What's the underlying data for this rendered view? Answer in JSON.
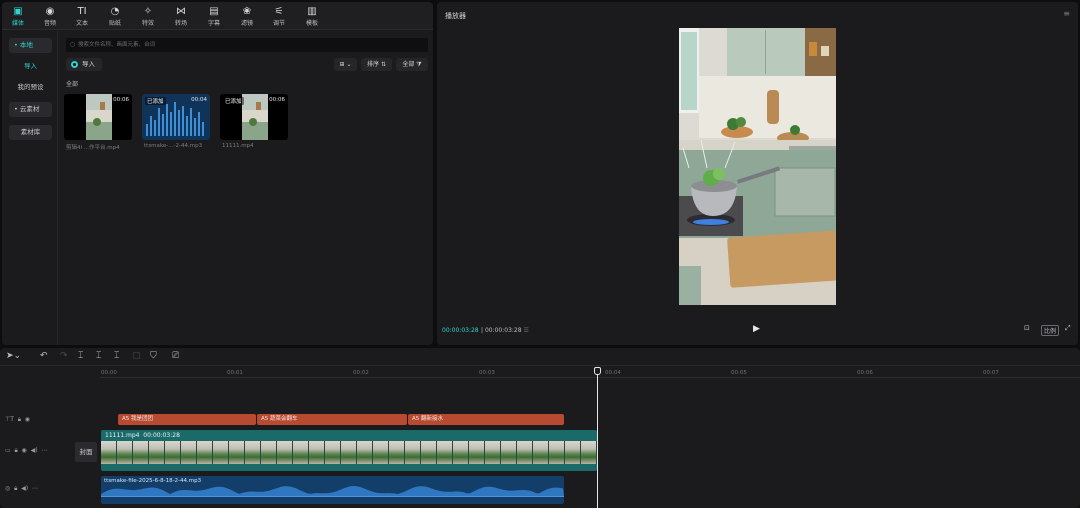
{
  "toolbar": {
    "items": [
      {
        "label": "媒体",
        "icon": "media-icon",
        "glyph": "▣"
      },
      {
        "label": "音频",
        "icon": "audio-icon",
        "glyph": "◉"
      },
      {
        "label": "文本",
        "icon": "text-icon",
        "glyph": "TI"
      },
      {
        "label": "贴纸",
        "icon": "sticker-icon",
        "glyph": "◔"
      },
      {
        "label": "特效",
        "icon": "effects-icon",
        "glyph": "✧"
      },
      {
        "label": "转场",
        "icon": "transition-icon",
        "glyph": "⋈"
      },
      {
        "label": "字幕",
        "icon": "captions-icon",
        "glyph": "▤"
      },
      {
        "label": "滤镜",
        "icon": "filter-icon",
        "glyph": "❀"
      },
      {
        "label": "调节",
        "icon": "adjust-icon",
        "glyph": "⚟"
      },
      {
        "label": "模板",
        "icon": "template-icon",
        "glyph": "▥"
      }
    ],
    "accent": "#2fd3d0"
  },
  "sidebar": {
    "items": [
      {
        "label": "• 本地"
      },
      {
        "label": "导入"
      },
      {
        "label": "我的预设"
      },
      {
        "label": "• 云素材"
      },
      {
        "label": "素材库"
      }
    ]
  },
  "search": {
    "placeholder": "搜索文件名称、画面元素、台词"
  },
  "media": {
    "import_label": "导入",
    "sort_label": "排序",
    "filter_label": "全部",
    "section_label": "全部",
    "items": [
      {
        "name": "剪辑4i ...作平台.mp4",
        "duration": "00:06",
        "badge": ""
      },
      {
        "name": "ttsmake-...-2-44.mp3",
        "duration": "00:04",
        "badge": "已添加"
      },
      {
        "name": "11111.mp4",
        "duration": "00:06",
        "badge": "已添加"
      }
    ]
  },
  "player": {
    "title": "播放器",
    "current_time": "00:00:03:28",
    "total_time": "00:00:03:28",
    "ratio_label": "比例"
  },
  "timeline": {
    "ruler": [
      "00:00",
      "00:01",
      "00:02",
      "00:03",
      "00:04",
      "00:05",
      "00:06",
      "00:07"
    ],
    "text_clips": [
      {
        "label": "A5 我是团团"
      },
      {
        "label": "A5 蔬菜会翻车"
      },
      {
        "label": "A5 翻新接水"
      }
    ],
    "video_clip": {
      "name": "11111.mp4",
      "duration": "00:00:03:28"
    },
    "cover_label": "封面",
    "audio_clip": {
      "name": "ttsmake-file-2025-6-8-18-2-44.mp3"
    },
    "video_color": "#1a6a6a",
    "audio_color": "#143e6a",
    "text_color": "#b84a32"
  }
}
